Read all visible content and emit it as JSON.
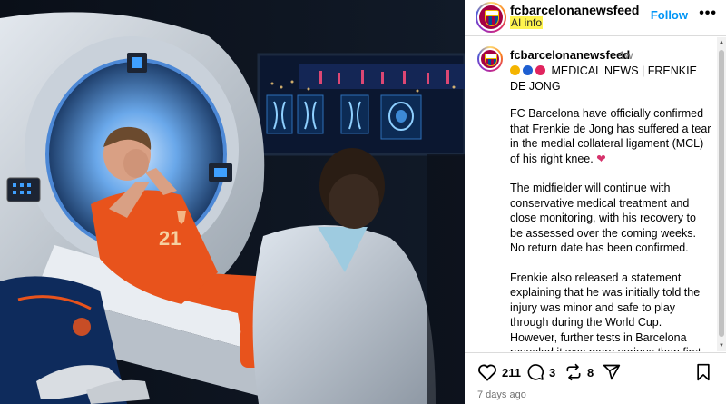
{
  "header": {
    "username": "fcbarcelonanewsfeed",
    "ai_label": "AI info",
    "follow_label": "Follow",
    "more_label": "•••"
  },
  "caption": {
    "username": "fcbarcelonanewsfeed",
    "time": "1w",
    "emoji_colors": [
      "#f4b400",
      "#1e5fd1",
      "#e0245e"
    ],
    "headline": "MEDICAL NEWS | FRENKIE DE JONG",
    "paragraphs": [
      "FC Barcelona have officially confirmed that Frenkie de Jong has suffered a tear in the medial collateral ligament (MCL) of his right knee.",
      "The midfielder will continue with conservative medical treatment and close monitoring, with his recovery to be assessed over the coming weeks. No return date has been confirmed.",
      "Frenkie also released a statement explaining that he was initially told the injury was minor and safe to play through during the World Cup. However, further tests in Barcelona revealed it was more serious than first believed. He confirmed that surgery is"
    ]
  },
  "actions": {
    "likes": "211",
    "comments": "3",
    "reposts": "8"
  },
  "post_date": "7 days ago",
  "media": {
    "jersey_number": "21"
  },
  "colors": {
    "accent": "#0095f6",
    "highlight": "#fff44f",
    "jersey": "#e8531c"
  }
}
